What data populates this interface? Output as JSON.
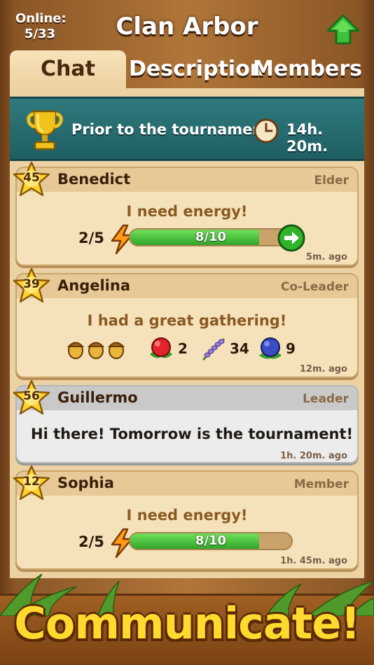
{
  "header": {
    "online_label": "Online:",
    "online_count": "5/33",
    "clan_name": "Clan Arbor"
  },
  "tabs": [
    {
      "label": "Chat",
      "active": true
    },
    {
      "label": "Description",
      "active": false
    },
    {
      "label": "Members",
      "active": false
    }
  ],
  "banner": {
    "text": "Prior to the tournament:",
    "timer": "14h. 20m."
  },
  "messages": [
    {
      "level": "45",
      "name": "Benedict",
      "role": "Elder",
      "text": "I need energy!",
      "energy_request": "2/5",
      "progress_label": "8/10",
      "progress": 0.8,
      "time": "5m. ago"
    },
    {
      "level": "39",
      "name": "Angelina",
      "role": "Co-Leader",
      "text": "I had a great gathering!",
      "items": [
        {
          "icon": "acorns-icon",
          "qty": ""
        },
        {
          "icon": "berry-icon",
          "qty": "2"
        },
        {
          "icon": "lavender-icon",
          "qty": "34"
        },
        {
          "icon": "blueberry-icon",
          "qty": "9"
        }
      ],
      "time": "12m. ago"
    },
    {
      "level": "56",
      "name": "Guillermo",
      "role": "Leader",
      "text": "Hi there! Tomorrow is the tournament!",
      "time": "1h. 20m. ago"
    },
    {
      "level": "12",
      "name": "Sophia",
      "role": "Member",
      "text": "I need energy!",
      "energy_request": "2/5",
      "progress_label": "8/10",
      "progress": 0.8,
      "time": "1h. 45m. ago"
    }
  ],
  "footer": {
    "caption": "Communicate!"
  },
  "colors": {
    "teal_banner": "#2f7a7d",
    "progress_green": "#2fa52a",
    "caption_yellow": "#ffd92e",
    "wood": "#b07639"
  }
}
